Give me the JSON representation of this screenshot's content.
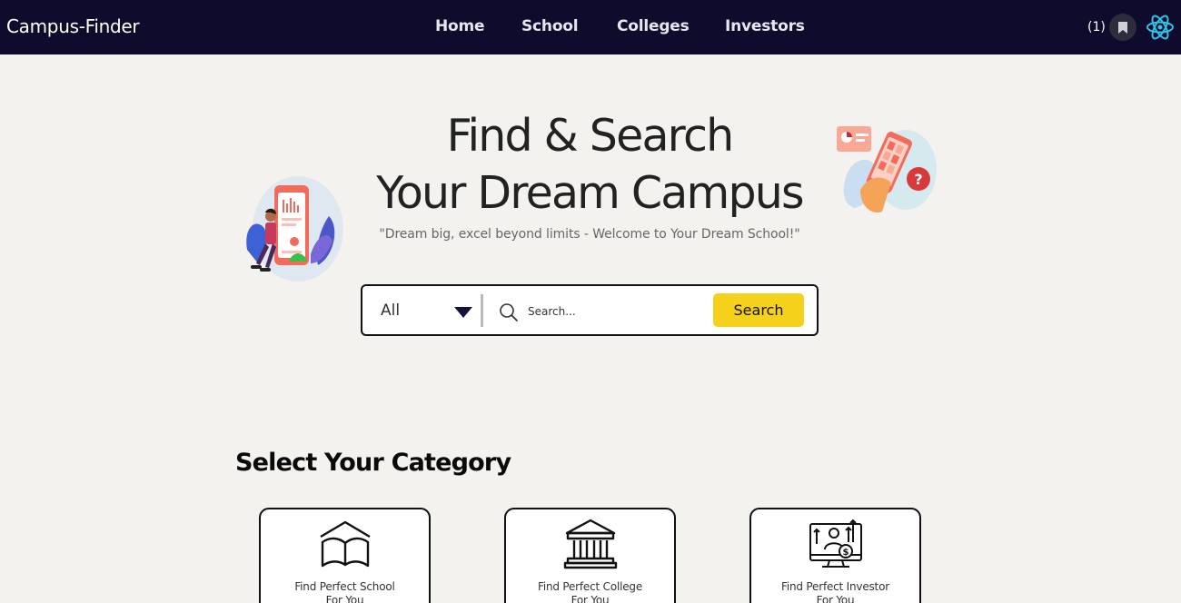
{
  "navbar": {
    "brand": "Campus-Finder",
    "links": [
      {
        "label": "Home"
      },
      {
        "label": "School"
      },
      {
        "label": "Colleges"
      },
      {
        "label": "Investors"
      }
    ],
    "bookmark_count": "(1)",
    "icons": {
      "bookmark": "bookmark-icon",
      "logo": "atom-logo-icon"
    },
    "colors": {
      "background": "#0e0b2d",
      "text": "#ffffff",
      "logo": "#2fc3e8"
    }
  },
  "hero": {
    "title_line1": "Find & Search",
    "title_line2": "Your Dream Campus",
    "tagline": "\"Dream big, excel beyond limits - Welcome to Your Dream School!\""
  },
  "search": {
    "category_value": "All",
    "placeholder": "Search...",
    "button_label": "Search",
    "colors": {
      "button": "#f6d11b",
      "arrow": "#14123a"
    }
  },
  "categories": {
    "title": "Select Your Category",
    "items": [
      {
        "label_line1": "Find Perfect School",
        "label_line2": "For You",
        "icon": "book-icon"
      },
      {
        "label_line1": "Find Perfect College",
        "label_line2": "For You",
        "icon": "institution-building-icon"
      },
      {
        "label_line1": "Find Perfect Investor",
        "label_line2": "For You",
        "icon": "investor-monitor-icon"
      }
    ]
  }
}
